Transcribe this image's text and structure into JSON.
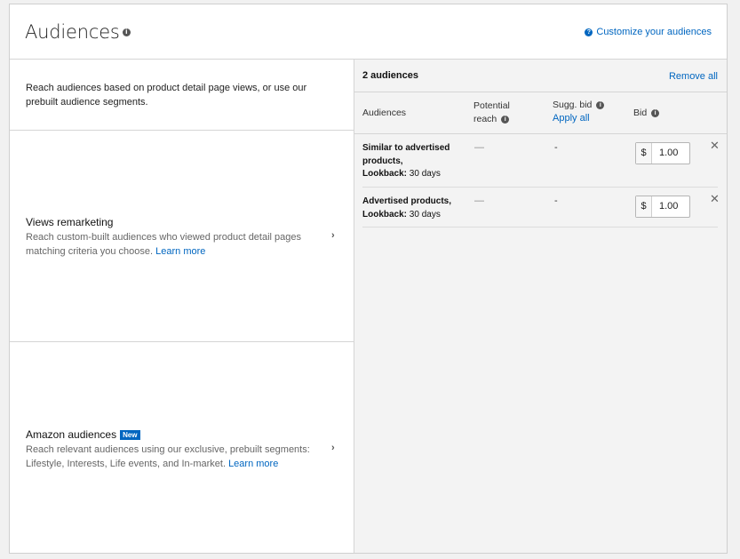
{
  "header": {
    "title": "Audiences",
    "customize_link": "Customize your audiences"
  },
  "left": {
    "intro": "Reach audiences based on product detail page views, or use our prebuilt audience segments.",
    "options": [
      {
        "title": "Views remarketing",
        "description": "Reach custom-built audiences who viewed product detail pages matching criteria you choose.",
        "link": "Learn more"
      },
      {
        "title": "Amazon audiences",
        "badge": "New",
        "description": "Reach relevant audiences using our exclusive, prebuilt segments: Lifestyle, Interests, Life events, and In-market.",
        "link": "Learn more"
      }
    ]
  },
  "right": {
    "count": "2 audiences",
    "remove_all": "Remove all",
    "columns": {
      "audiences": "Audiences",
      "reach_line1": "Potential",
      "reach_line2": "reach",
      "sugg_bid": "Sugg. bid",
      "apply_all": "Apply all",
      "bid": "Bid"
    },
    "rows": [
      {
        "name": "Similar to advertised products,",
        "lookback_label": "Lookback:",
        "lookback_value": "30 days",
        "reach": "—",
        "sugg_bid": "-",
        "currency": "$",
        "bid": "1.00"
      },
      {
        "name": "Advertised products,",
        "lookback_label": "Lookback:",
        "lookback_value": "30 days",
        "reach": "—",
        "sugg_bid": "-",
        "currency": "$",
        "bid": "1.00"
      }
    ]
  },
  "icons": {
    "info": "info-icon",
    "question": "question-icon",
    "chevron": "chevron-right-icon",
    "close": "close-icon"
  },
  "colors": {
    "link": "#0066c0",
    "badge": "#0066c0",
    "panel_bg": "#f3f3f3"
  }
}
